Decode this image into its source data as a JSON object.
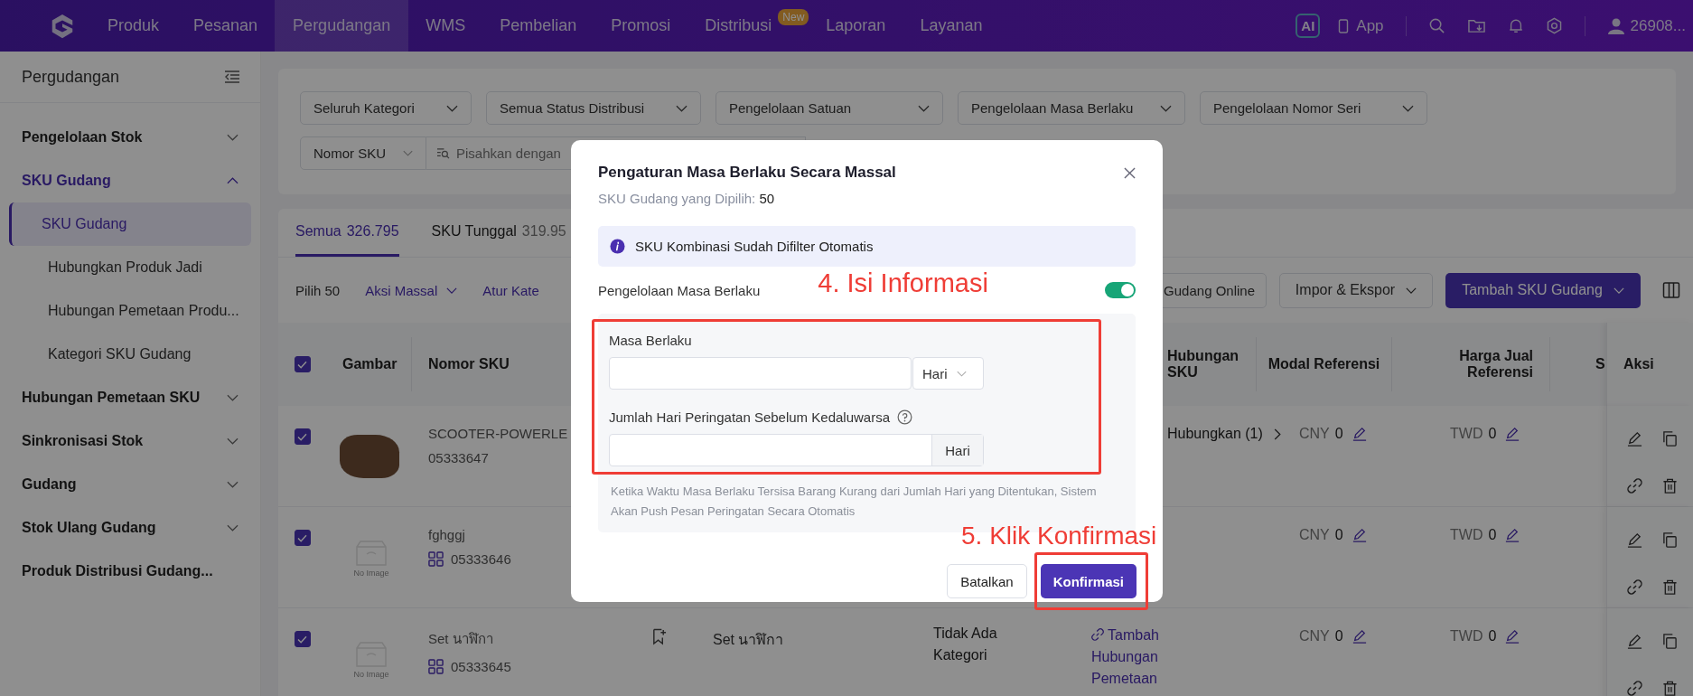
{
  "nav": {
    "items": [
      {
        "label": "Produk",
        "selected": false
      },
      {
        "label": "Pesanan",
        "selected": false
      },
      {
        "label": "Pergudangan",
        "selected": true
      },
      {
        "label": "WMS",
        "selected": false
      },
      {
        "label": "Pembelian",
        "selected": false
      },
      {
        "label": "Promosi",
        "selected": false
      },
      {
        "label": "Distribusi",
        "selected": false,
        "badge": "New"
      },
      {
        "label": "Laporan",
        "selected": false
      },
      {
        "label": "Layanan",
        "selected": false
      }
    ],
    "ai_label": "AI",
    "app_label": "App",
    "user": "26908..."
  },
  "sidebar": {
    "title": "Pergudangan",
    "items": [
      {
        "label": "Pengelolaan Stok",
        "kind": "group",
        "expanded": false,
        "selected": false
      },
      {
        "label": "SKU Gudang",
        "kind": "group",
        "expanded": true,
        "selected": true,
        "children": [
          {
            "label": "SKU Gudang",
            "selected": true
          },
          {
            "label": "Hubungkan Produk Jadi",
            "selected": false
          },
          {
            "label": "Hubungan Pemetaan Produ...",
            "selected": false
          },
          {
            "label": "Kategori SKU Gudang",
            "selected": false
          }
        ]
      },
      {
        "label": "Hubungan Pemetaan SKU",
        "kind": "group",
        "expanded": false,
        "selected": false
      },
      {
        "label": "Sinkronisasi Stok",
        "kind": "group",
        "expanded": false,
        "selected": false
      },
      {
        "label": "Gudang",
        "kind": "group",
        "expanded": false,
        "selected": false
      },
      {
        "label": "Stok Ulang Gudang",
        "kind": "group",
        "expanded": false,
        "selected": false
      },
      {
        "label": "Produk Distribusi Gudang...",
        "kind": "link",
        "selected": false
      }
    ]
  },
  "filters": {
    "selects": [
      "Seluruh Kategori",
      "Semua Status Distribusi",
      "Pengelolaan Satuan",
      "Pengelolaan Masa Berlaku",
      "Pengelolaan Nomor Seri"
    ],
    "search_type": "Nomor SKU",
    "search_placeholder": "Pisahkan dengan"
  },
  "tabs": [
    {
      "label": "Semua",
      "count": "326.795",
      "selected": true
    },
    {
      "label": "SKU Tunggal",
      "count": "319.95",
      "selected": false
    }
  ],
  "toolbar": {
    "selected_count": "Pilih 50",
    "bulk_action": "Aksi Massal",
    "set_category": "Atur Kate",
    "online_button": "Gudang Online",
    "import_export": "Impor & Ekspor",
    "add_button": "Tambah SKU Gudang"
  },
  "table": {
    "all_checked": true,
    "columns": [
      "Gambar",
      "Nomor SKU",
      "Hubungan SKU",
      "Modal Referensi",
      "Harga Jual Referensi",
      "S",
      "Aksi"
    ],
    "rows": [
      {
        "checked": true,
        "image": {
          "kind": "photo"
        },
        "sku_name": "SCOOTER-POWERLE",
        "sku_code": "05333647",
        "combo": false,
        "mapping": {
          "kind": "text",
          "text": "Hubungkan (1)"
        },
        "cost_currency": "CNY",
        "cost": "0",
        "price_currency": "TWD",
        "price": "0"
      },
      {
        "checked": true,
        "image": {
          "kind": "empty",
          "text": "No Image"
        },
        "sku_name": "fghggj",
        "sku_code": "05333646",
        "combo": true,
        "cost_currency": "CNY",
        "cost": "0",
        "price_currency": "TWD",
        "price": "0"
      },
      {
        "checked": true,
        "image": {
          "kind": "empty",
          "text": "No Image"
        },
        "sku_name": "Set นาฬิกา",
        "sku_code": "05333645",
        "combo": true,
        "name": "Set นาฬิกา",
        "category": "Tidak Ada Kategori",
        "mapping": {
          "kind": "link",
          "text": "Tambah Hubungan Pemetaan"
        },
        "cost_currency": "CNY",
        "cost": "0",
        "price_currency": "TWD",
        "price": "0"
      }
    ]
  },
  "modal": {
    "title": "Pengaturan Masa Berlaku Secara Massal",
    "selected_label": "SKU Gudang yang Dipilih:",
    "selected_value": "50",
    "info": "SKU Kombinasi Sudah Difilter Otomatis",
    "toggle_label": "Pengelolaan Masa Berlaku",
    "toggle_on": true,
    "period_label": "Masa Berlaku",
    "period_unit": "Hari",
    "warning_label": "Jumlah Hari Peringatan Sebelum Kedaluwarsa",
    "warning_unit": "Hari",
    "hint": "Ketika Waktu Masa Berlaku Tersisa Barang Kurang dari Jumlah Hari yang Ditentukan, Sistem Akan Push Pesan Peringatan Secara Otomatis",
    "cancel": "Batalkan",
    "confirm": "Konfirmasi"
  },
  "annotations": {
    "fill_step": "4. Isi Informasi",
    "confirm_step": "5. Klik Konfirmasi"
  }
}
